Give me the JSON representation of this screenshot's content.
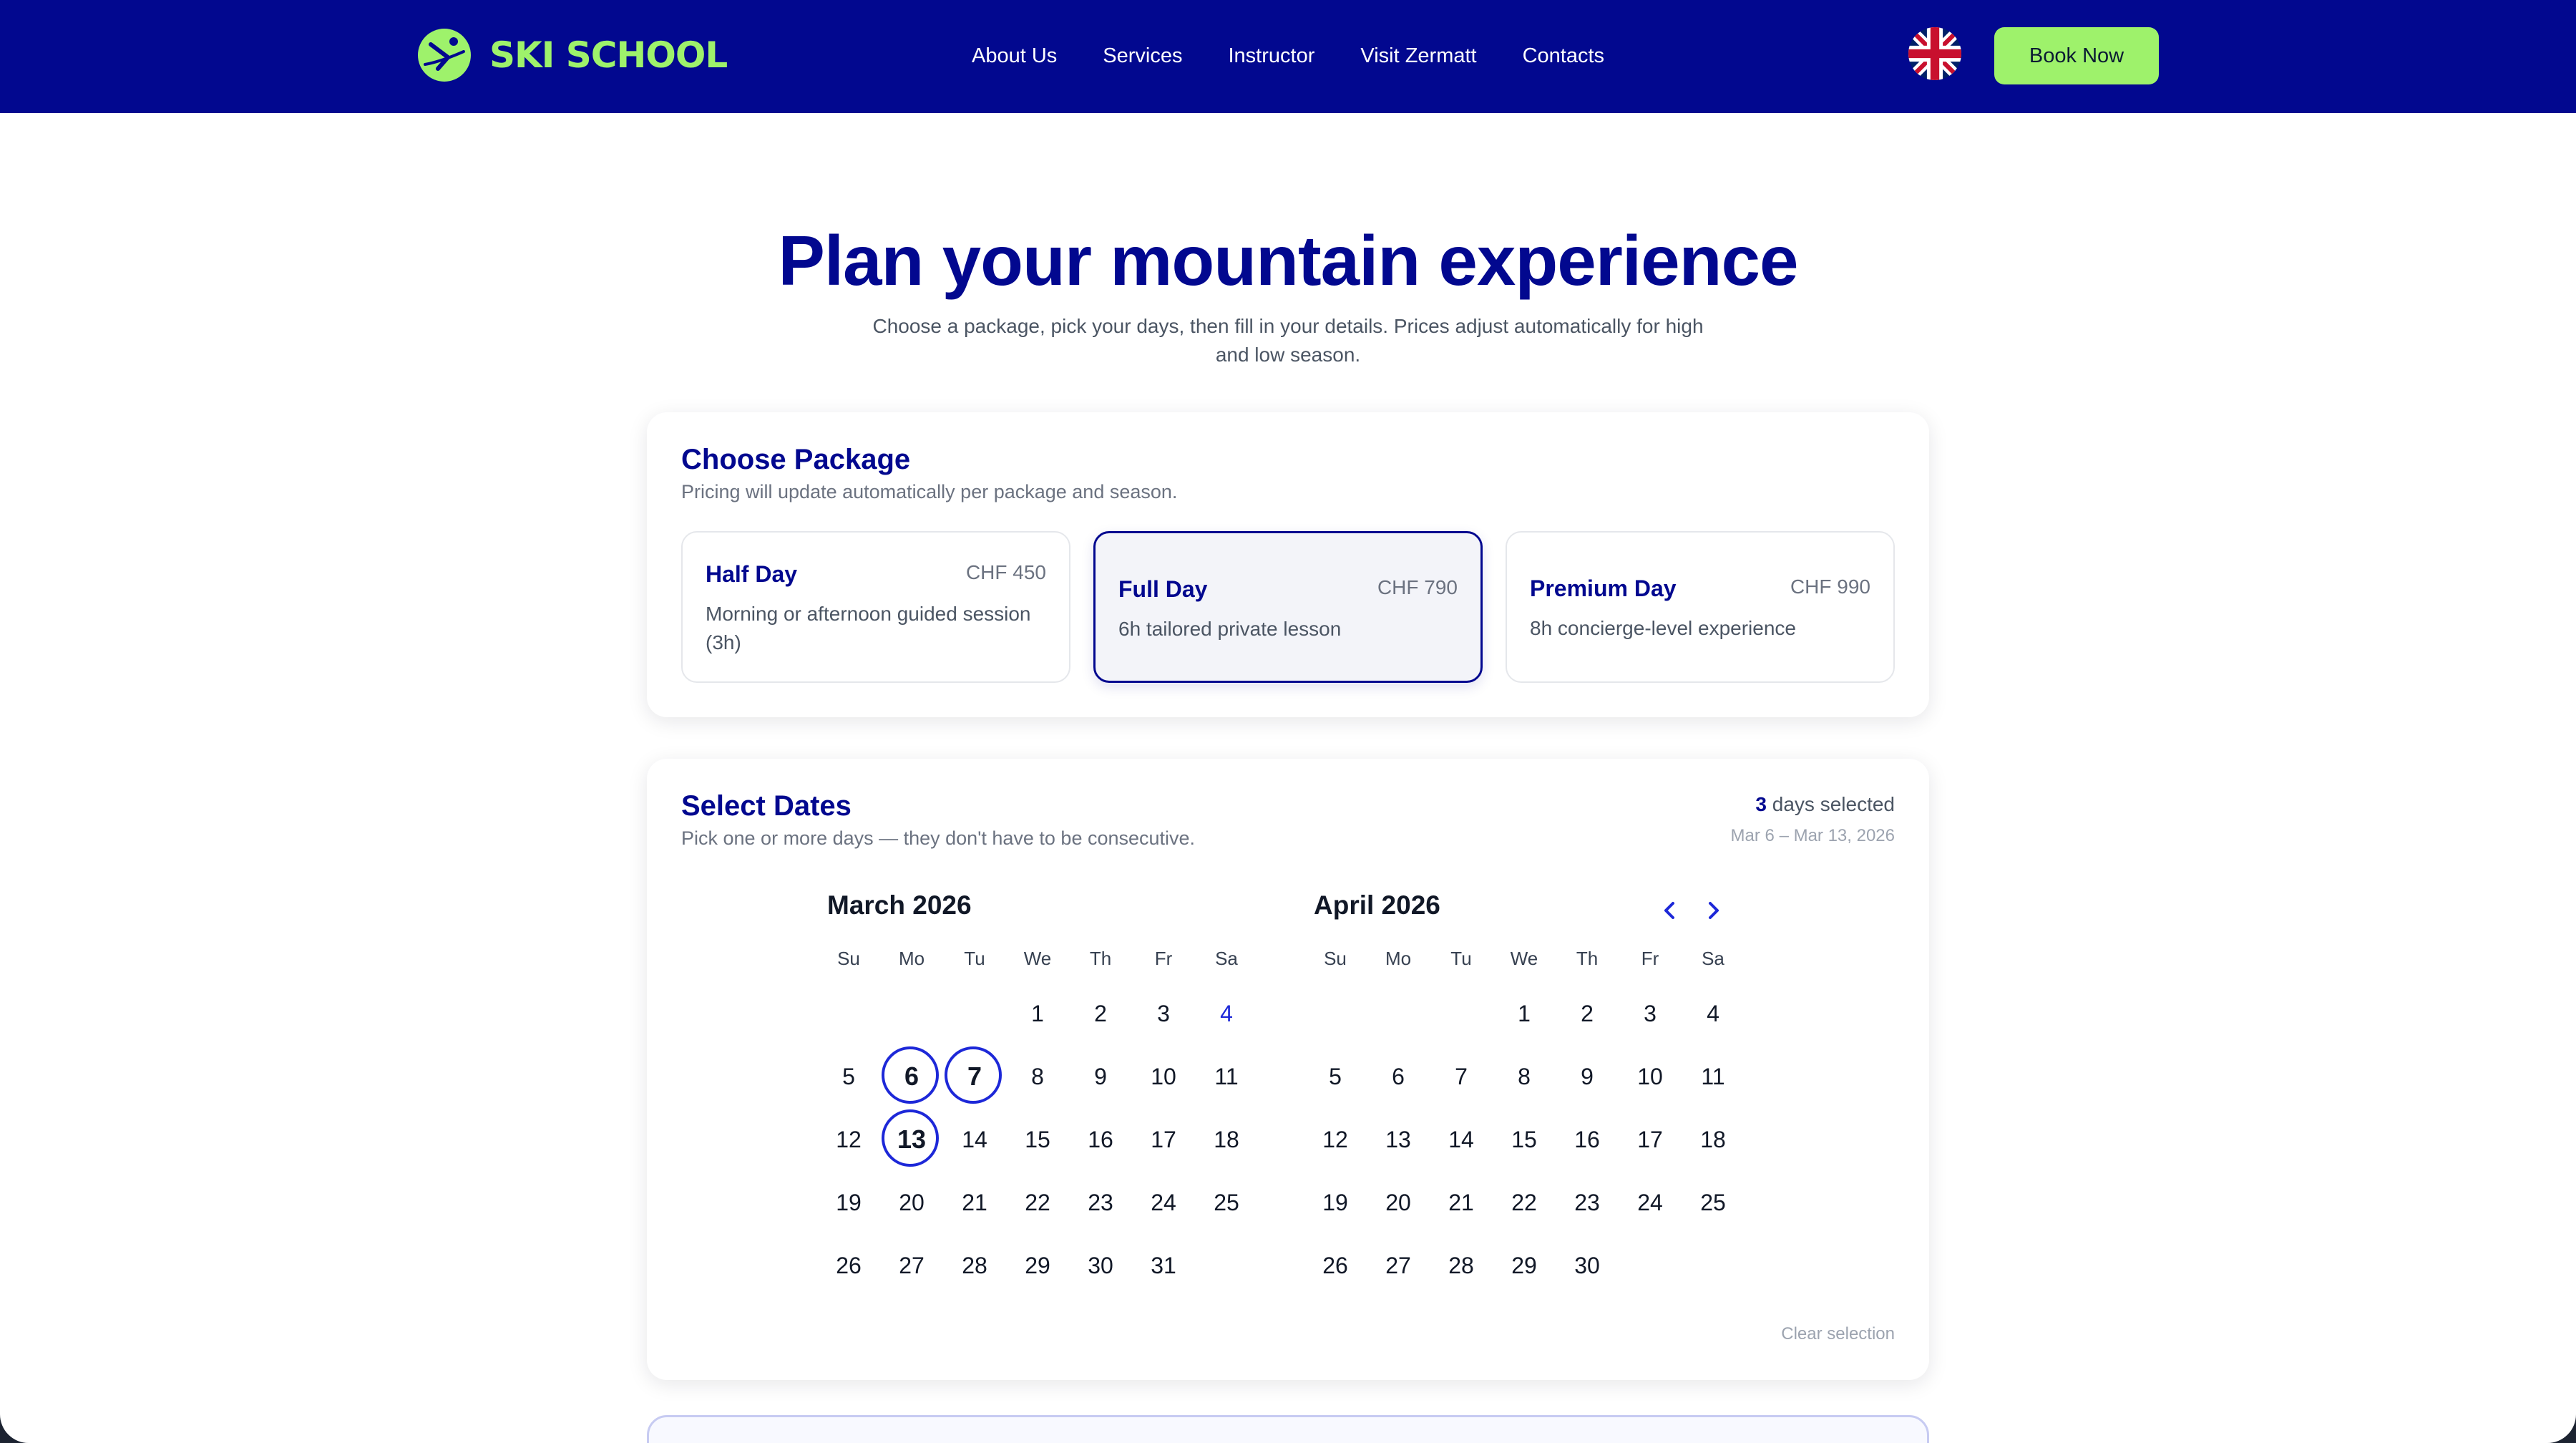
{
  "header": {
    "brand": "SKI SCHOOL",
    "nav": [
      "About Us",
      "Services",
      "Instructor",
      "Visit Zermatt",
      "Contacts"
    ],
    "language_icon": "uk-flag-icon",
    "book_label": "Book Now",
    "colors": {
      "navy": "#02088f",
      "lime": "#9ef26b"
    }
  },
  "hero": {
    "title": "Plan your mountain experience",
    "subtitle": "Choose a package, pick your days, then fill in your details. Prices adjust automatically for high and low season."
  },
  "package": {
    "title": "Choose Package",
    "description": "Pricing will update automatically per package and season.",
    "options": [
      {
        "name": "Half Day",
        "price": "CHF 450",
        "text": "Morning or afternoon guided session (3h)",
        "selected": false
      },
      {
        "name": "Full Day",
        "price": "CHF 790",
        "text": "6h tailored private lesson",
        "selected": true
      },
      {
        "name": "Premium Day",
        "price": "CHF 990",
        "text": "8h concierge-level experience",
        "selected": false
      }
    ]
  },
  "dates": {
    "title": "Select Dates",
    "description": "Pick one or more days — they don't have to be consecutive.",
    "count": "3",
    "count_suffix": " days selected",
    "range": "Mar 6 – Mar 13, 2026",
    "clear_label": "Clear selection",
    "weekdays": [
      "Su",
      "Mo",
      "Tu",
      "We",
      "Th",
      "Fr",
      "Sa"
    ],
    "months": [
      {
        "title": "March 2026",
        "offset": 3,
        "days": 31,
        "today": 4,
        "selected": [
          6,
          7,
          13
        ]
      },
      {
        "title": "April 2026",
        "offset": 3,
        "days": 30,
        "today": null,
        "selected": []
      }
    ],
    "prev_icon": "chevron-left-icon",
    "next_icon": "chevron-right-icon"
  }
}
